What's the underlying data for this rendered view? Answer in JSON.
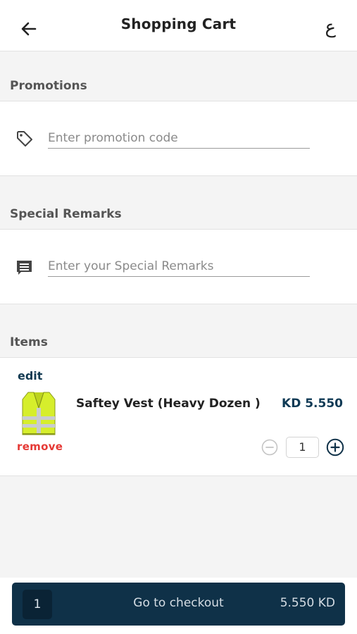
{
  "header": {
    "title": "Shopping Cart",
    "lang_toggle": "ع"
  },
  "promotions": {
    "label": "Promotions",
    "placeholder": "Enter promotion code"
  },
  "remarks": {
    "label": "Special Remarks",
    "placeholder": "Enter your Special Remarks"
  },
  "items": {
    "label": "Items",
    "list": [
      {
        "edit_label": "edit",
        "name": "Saftey Vest (Heavy Dozen )",
        "price": "KD 5.550",
        "remove_label": "remove",
        "quantity": "1"
      }
    ]
  },
  "checkout": {
    "count": "1",
    "label": "Go to checkout",
    "total": "5.550 KD"
  },
  "colors": {
    "primary": "#0f3148",
    "remove": "#e53935",
    "price": "#0f3a55",
    "background": "#f4f4f4"
  },
  "icons": {
    "back": "arrow-left-icon",
    "promo": "tag-icon",
    "remarks": "chat-icon",
    "minus": "minus-circle-icon",
    "plus": "plus-circle-icon"
  }
}
